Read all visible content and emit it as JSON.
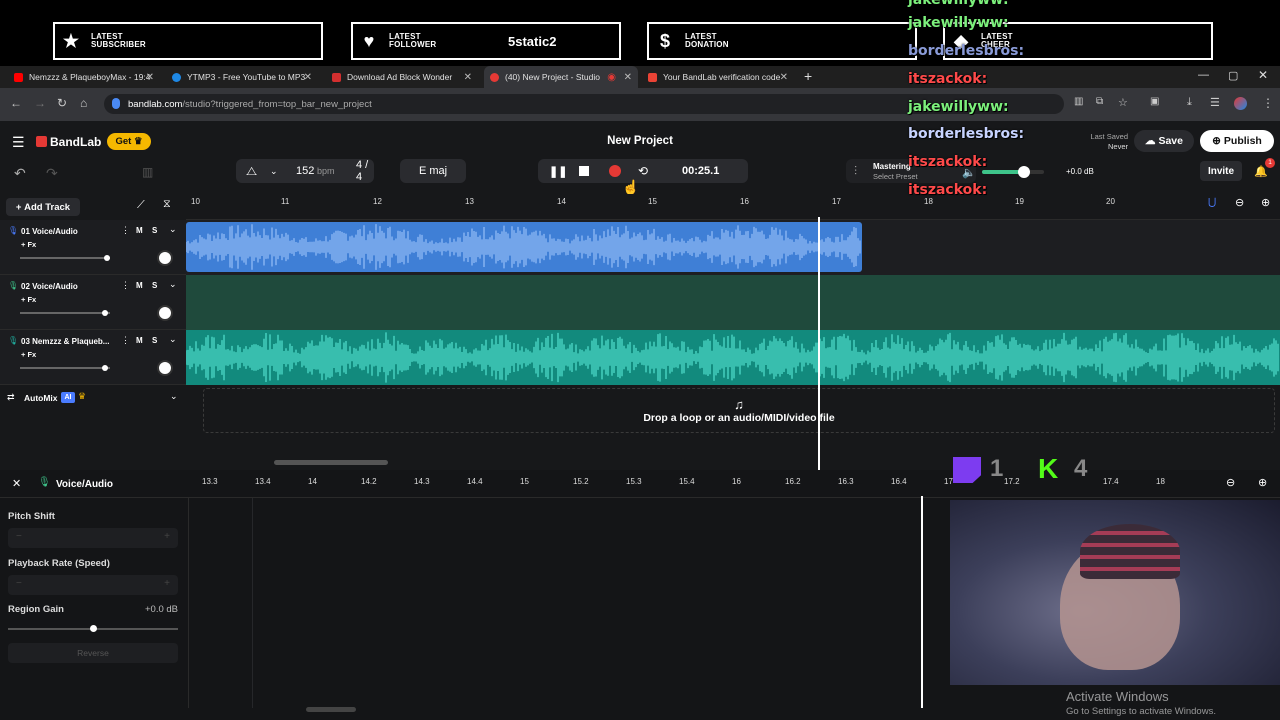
{
  "overlay": {
    "alerts": [
      {
        "icon": "star-icon",
        "label_l1": "LATEST",
        "label_l2": "SUBSCRIBER",
        "value": ""
      },
      {
        "icon": "heart-icon",
        "label_l1": "LATEST",
        "label_l2": "FOLLOWER",
        "value": "5static2"
      },
      {
        "icon": "dollar-icon",
        "label_l1": "LATEST",
        "label_l2": "DONATION",
        "value": ""
      },
      {
        "icon": "diamond-icon",
        "label_l1": "LATEST",
        "label_l2": "CHEER",
        "value": ""
      }
    ],
    "chat": [
      {
        "user": "jakewillyww:",
        "color": "#7cf07c"
      },
      {
        "user": "borderlesbros:",
        "color": "#8a9bd8"
      },
      {
        "user": "itszackok:",
        "color": "#ff4a4a"
      },
      {
        "user": "jakewillyww:",
        "color": "#7cf07c"
      },
      {
        "user": "borderlesbros:",
        "color": "#c7d3ff"
      },
      {
        "user": "itszackok:",
        "color": "#ff4a4a"
      },
      {
        "user": "itszackok:",
        "color": "#ff4a4a"
      }
    ],
    "counter_twitch": "1",
    "counter_kick": "4"
  },
  "browser": {
    "tabs": [
      {
        "title": "Nemzzz & PlaqueboyMax - 19:4",
        "favcolor": "#ff0000"
      },
      {
        "title": "YTMP3 - Free YouTube to MP3",
        "favcolor": "#1e88e5"
      },
      {
        "title": "Download Ad Block Wonder",
        "favcolor": "#d32f2f"
      },
      {
        "title": "(40) New Project - Studio",
        "favcolor": "#e53935"
      },
      {
        "title": "Your BandLab verification code",
        "favcolor": "#ea4335"
      }
    ],
    "url_host": "bandlab.com",
    "url_path": "/studio?triggered_from=top_bar_new_project"
  },
  "app": {
    "brand": "BandLab",
    "get_label": "Get",
    "project_title": "New Project",
    "last_saved_label": "Last Saved",
    "last_saved_value": "Never",
    "save_label": "Save",
    "publish_label": "Publish",
    "invite_label": "Invite",
    "notif_count": "1",
    "tempo": "152",
    "tempo_unit": "bpm",
    "time_sig_num": "4",
    "time_sig_den": "4",
    "key": "E maj",
    "time": "00:25.1",
    "mastering_label": "Mastering",
    "mastering_preset": "Select Preset",
    "master_db": "+0.0 dB",
    "add_track_label": "Add Track",
    "ruler": [
      "10",
      "11",
      "12",
      "13",
      "14",
      "15",
      "16",
      "17",
      "18",
      "19",
      "20"
    ],
    "tracks": [
      {
        "name": "01 Voice/Audio",
        "fx": "+ Fx",
        "m": "M",
        "s": "S",
        "color": "#3f7fd6"
      },
      {
        "name": "02 Voice/Audio",
        "fx": "+ Fx",
        "m": "M",
        "s": "S",
        "color": "#1f4a3c"
      },
      {
        "name": "03 Nemzzz & Plaqueb...",
        "fx": "+ Fx",
        "m": "M",
        "s": "S",
        "color": "#20b3a3"
      }
    ],
    "automix_label": "AutoMix",
    "automix_badge": "AI",
    "drop_text": "Drop a loop or an audio/MIDI/video file"
  },
  "editor": {
    "title": "Voice/Audio",
    "ruler": [
      "13.3",
      "13.4",
      "14",
      "14.2",
      "14.3",
      "14.4",
      "15",
      "15.2",
      "15.3",
      "15.4",
      "16",
      "16.2",
      "16.3",
      "16.4",
      "17",
      "17.2",
      "17.4",
      "18"
    ],
    "pitch_label": "Pitch Shift",
    "rate_label": "Playback Rate (Speed)",
    "gain_label": "Region Gain",
    "gain_value": "+0.0 dB",
    "reverse_label": "Reverse"
  },
  "windows": {
    "activate_title": "Activate Windows",
    "activate_sub": "Go to Settings to activate Windows."
  }
}
